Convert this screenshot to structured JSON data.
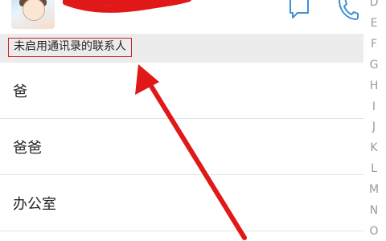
{
  "section_header": {
    "label": "未启用通讯录的联系人"
  },
  "contacts": [
    {
      "name": "爸"
    },
    {
      "name": "爸爸"
    },
    {
      "name": "办公室"
    }
  ],
  "alphabet_index": [
    "D",
    "E",
    "F",
    "G",
    "H",
    "I",
    "J",
    "K",
    "L",
    "M",
    "N",
    "O"
  ],
  "icons": {
    "message": "message-icon",
    "phone": "phone-icon",
    "annotation_arrow": "red-arrow"
  },
  "colors": {
    "accent_blue": "#3f8fd6",
    "annotation_red": "#d21f1f",
    "section_bg": "#ececec",
    "index_gray": "#9a9a9a"
  }
}
